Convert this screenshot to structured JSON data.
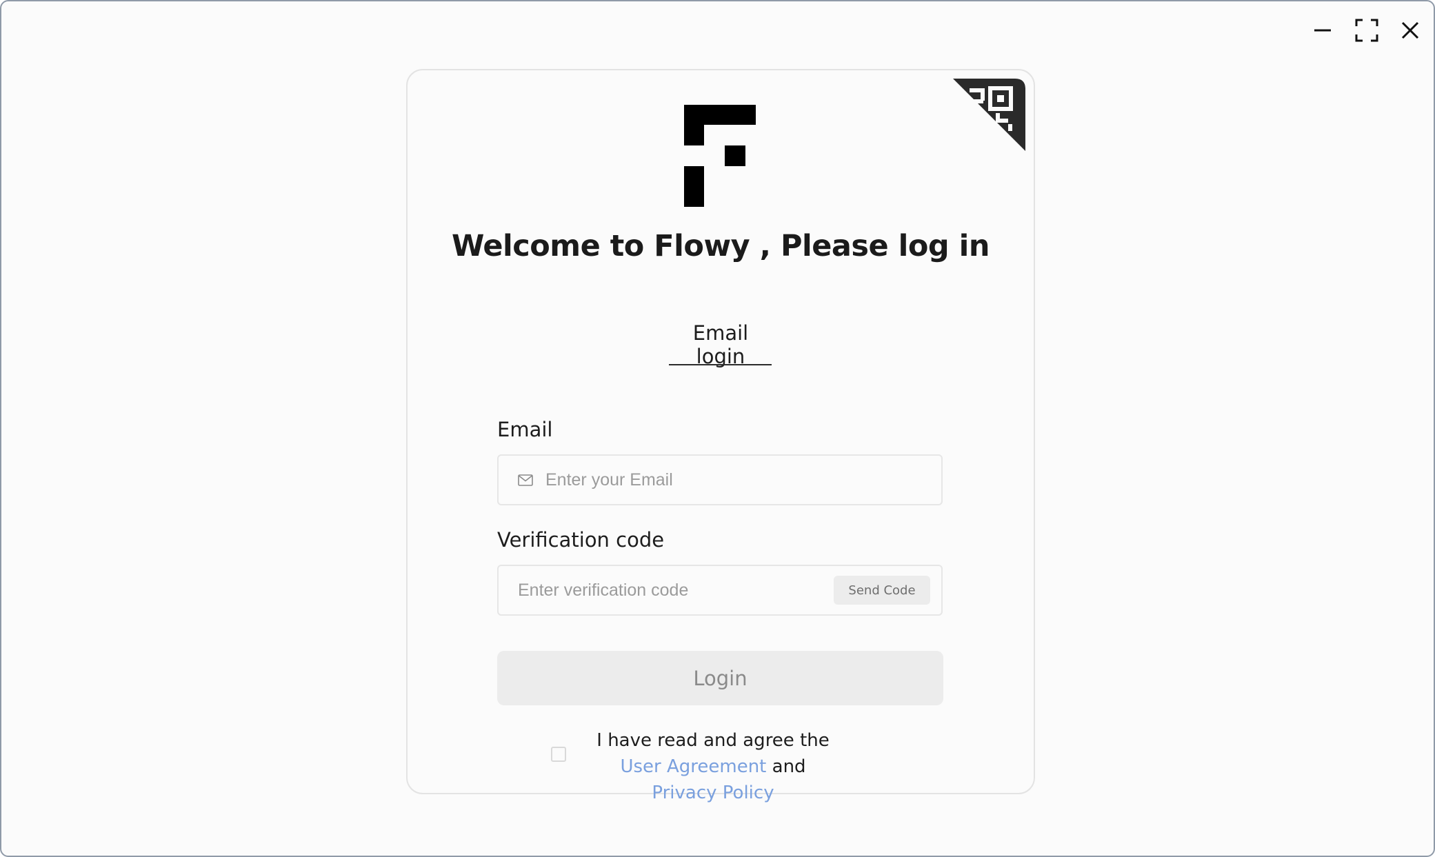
{
  "window": {
    "controls": [
      "minimize",
      "maximize",
      "close"
    ]
  },
  "login": {
    "title": "Welcome to Flowy , Please log in",
    "tab_label": "Email login",
    "email": {
      "label": "Email",
      "value": "",
      "placeholder": "Enter your Email",
      "icon": "mail-icon"
    },
    "code": {
      "label": "Verification code",
      "value": "",
      "placeholder": "Enter verification code",
      "send_code_label": "Send Code"
    },
    "login_label": "Login",
    "agreement": {
      "checked": false,
      "prefix": "I have read and agree the",
      "user_agreement": "User Agreement",
      "conjunction": "and",
      "privacy_policy": "Privacy Policy",
      "link_color": "#7aa0de"
    }
  }
}
